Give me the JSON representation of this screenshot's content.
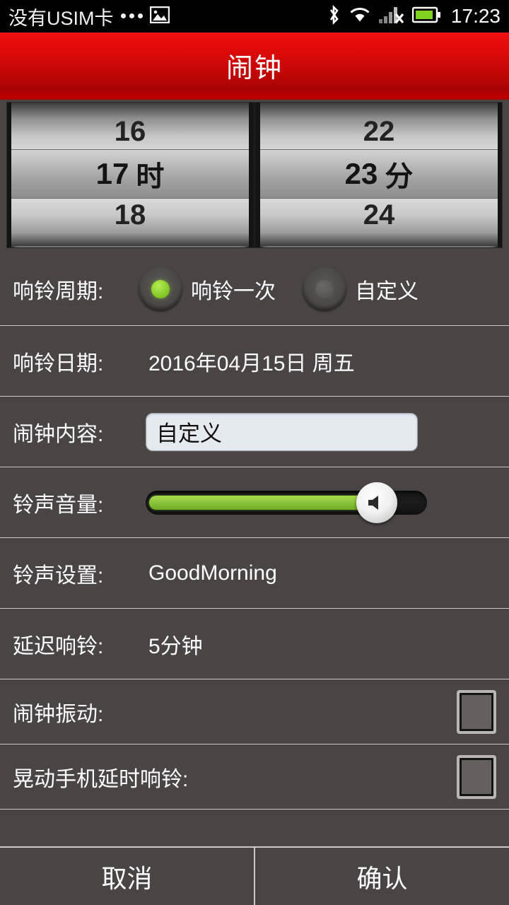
{
  "status_bar": {
    "carrier": "没有USIM卡",
    "icons": [
      "more-dots",
      "image-icon",
      "bluetooth-icon",
      "wifi-icon",
      "signal-no-service-icon",
      "battery-icon"
    ],
    "time": "17:23",
    "battery_color": "#7ed321"
  },
  "title_bar": {
    "title": "闹钟",
    "accent_color": "#d40808"
  },
  "time_picker": {
    "hour": {
      "prev": "16",
      "current": "17",
      "next": "18",
      "unit": "时"
    },
    "minute": {
      "prev": "22",
      "current": "23",
      "next": "24",
      "unit": "分"
    }
  },
  "rows": {
    "period": {
      "label": "响铃周期:",
      "options": [
        {
          "label": "响铃一次",
          "selected": true
        },
        {
          "label": "自定义",
          "selected": false
        }
      ],
      "selected_color": "#8cc63f"
    },
    "date": {
      "label": "响铃日期:",
      "value": "2016年04月15日 周五"
    },
    "content": {
      "label": "闹钟内容:",
      "value": "自定义",
      "placeholder": "自定义"
    },
    "volume": {
      "label": "铃声音量:",
      "percent": 80,
      "fill_color": "#8cc63f",
      "thumb_icon": "speaker-icon"
    },
    "tone": {
      "label": "铃声设置:",
      "value": "GoodMorning"
    },
    "snooze": {
      "label": "延迟响铃:",
      "value": "5分钟"
    },
    "vibrate": {
      "label": "闹钟振动:",
      "checked": false
    },
    "shake": {
      "label": "晃动手机延时响铃:",
      "checked": false
    }
  },
  "buttons": {
    "cancel": "取消",
    "confirm": "确认"
  }
}
